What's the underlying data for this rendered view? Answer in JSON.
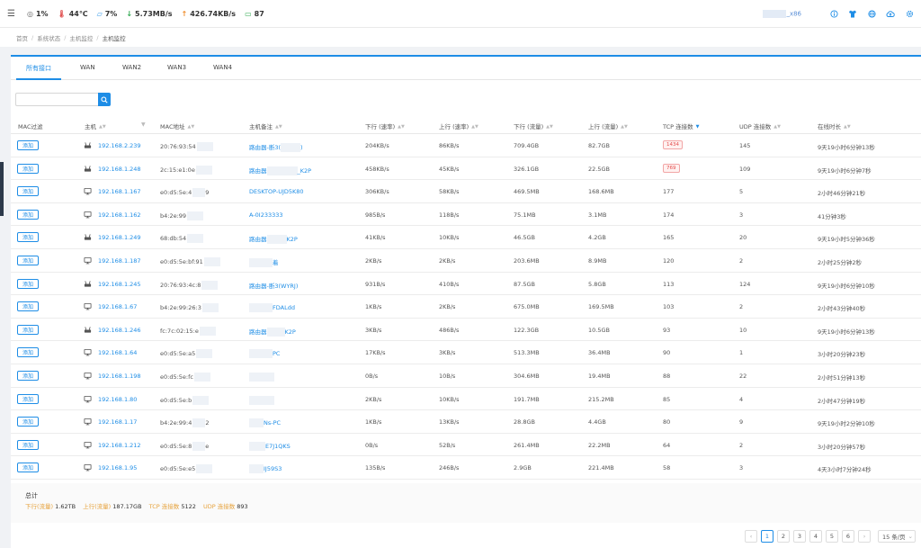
{
  "topbar": {
    "stats": [
      {
        "icon": "cpu-icon",
        "value": "1%",
        "color": "#666666"
      },
      {
        "icon": "thermometer-icon",
        "value": "44℃",
        "color": "#e04f4f"
      },
      {
        "icon": "memory-icon",
        "value": "7%",
        "color": "#3a9be8"
      },
      {
        "icon": "download-arrow-icon",
        "value": "5.73MB/s",
        "color": "#2fa84f"
      },
      {
        "icon": "upload-arrow-icon",
        "value": "426.74KB/s",
        "color": "#f08c2a"
      },
      {
        "icon": "monitor-icon",
        "value": "87",
        "color": "#2fa84f"
      }
    ],
    "arch": "_x86"
  },
  "breadcrumb": [
    "首页",
    "系统状态",
    "主机监控",
    "主机监控"
  ],
  "tabs": [
    "所有接口",
    "WAN",
    "WAN2",
    "WAN3",
    "WAN4"
  ],
  "search": {
    "placeholder": ""
  },
  "columns": [
    "MAC过滤",
    "主机",
    "MAC地址",
    "主机备注",
    "下行 (速率)",
    "上行 (速率)",
    "下行 (流量)",
    "上行 (流量)",
    "TCP 连接数",
    "UDP 连接数",
    "在线时长"
  ],
  "add_label": "添加",
  "rows": [
    {
      "icon": "router",
      "ip": "192.168.2.239",
      "mac": "20:76:93:54",
      "remark": "路由器-断3(",
      "remark_tail": ")",
      "down_rate": "204KB/s",
      "up_rate": "86KB/s",
      "down_total": "709.4GB",
      "up_total": "82.7GB",
      "tcp": "1434",
      "tcp_hot": true,
      "udp": "145",
      "online": "9天19小时6分钟13秒"
    },
    {
      "icon": "router",
      "ip": "192.168.1.248",
      "mac": "2c:15:e1:0e",
      "remark": "路由器",
      "remark_tail": "_K2P",
      "down_rate": "458KB/s",
      "up_rate": "45KB/s",
      "down_total": "326.1GB",
      "up_total": "22.5GB",
      "tcp": "769",
      "tcp_hot": true,
      "udp": "109",
      "online": "9天19小时6分钟7秒"
    },
    {
      "icon": "monitor",
      "ip": "192.168.1.167",
      "mac": "e0:d5:5e:4",
      "mac_tail": "9",
      "remark": "DESKTOP-UJD5K80",
      "remark_tail": "",
      "down_rate": "306KB/s",
      "up_rate": "58KB/s",
      "down_total": "469.5MB",
      "up_total": "168.6MB",
      "tcp": "177",
      "tcp_hot": false,
      "udp": "5",
      "online": "2小时46分钟21秒"
    },
    {
      "icon": "monitor",
      "ip": "192.168.1.162",
      "mac": "b4:2e:99",
      "remark": "A-0I233333",
      "remark_tail": "",
      "down_rate": "985B/s",
      "up_rate": "118B/s",
      "down_total": "75.1MB",
      "up_total": "3.1MB",
      "tcp": "174",
      "tcp_hot": false,
      "udp": "3",
      "online": "41分钟3秒"
    },
    {
      "icon": "router",
      "ip": "192.168.1.249",
      "mac": "68:db:54",
      "remark": "路由器",
      "remark_tail": "K2P",
      "down_rate": "41KB/s",
      "up_rate": "10KB/s",
      "down_total": "46.5GB",
      "up_total": "4.2GB",
      "tcp": "165",
      "tcp_hot": false,
      "udp": "20",
      "online": "9天19小时5分钟36秒"
    },
    {
      "icon": "monitor",
      "ip": "192.168.1.187",
      "mac": "e0:d5:5e:bf:91",
      "remark": "",
      "remark_tail": "着",
      "down_rate": "2KB/s",
      "up_rate": "2KB/s",
      "down_total": "203.6MB",
      "up_total": "8.9MB",
      "tcp": "120",
      "tcp_hot": false,
      "udp": "2",
      "online": "2小时25分钟2秒"
    },
    {
      "icon": "router",
      "ip": "192.168.1.245",
      "mac": "20:76:93:4c:8",
      "remark": "路由器-断3(WYRJ)",
      "remark_tail": "",
      "down_rate": "931B/s",
      "up_rate": "410B/s",
      "down_total": "87.5GB",
      "up_total": "5.8GB",
      "tcp": "113",
      "tcp_hot": false,
      "udp": "124",
      "online": "9天19小时6分钟10秒"
    },
    {
      "icon": "monitor",
      "ip": "192.168.1.67",
      "mac": "b4:2e:99:26:3",
      "remark": "",
      "remark_tail": "FDALdd",
      "down_rate": "1KB/s",
      "up_rate": "2KB/s",
      "down_total": "675.0MB",
      "up_total": "169.5MB",
      "tcp": "103",
      "tcp_hot": false,
      "udp": "2",
      "online": "2小时43分钟40秒"
    },
    {
      "icon": "router",
      "ip": "192.168.1.246",
      "mac": "fc:7c:02:15:e",
      "remark": "路由器",
      "remark_tail": "K2P",
      "down_rate": "3KB/s",
      "up_rate": "486B/s",
      "down_total": "122.3GB",
      "up_total": "10.5GB",
      "tcp": "93",
      "tcp_hot": false,
      "udp": "10",
      "online": "9天19小时6分钟13秒"
    },
    {
      "icon": "monitor",
      "ip": "192.168.1.64",
      "mac": "e0:d5:5e:a5",
      "remark": "",
      "remark_tail": "PC",
      "down_rate": "17KB/s",
      "up_rate": "3KB/s",
      "down_total": "513.3MB",
      "up_total": "36.4MB",
      "tcp": "90",
      "tcp_hot": false,
      "udp": "1",
      "online": "3小时20分钟23秒"
    },
    {
      "icon": "monitor",
      "ip": "192.168.1.198",
      "mac": "e0:d5:5e:fc",
      "remark": "",
      "remark_tail": "",
      "down_rate": "0B/s",
      "up_rate": "10B/s",
      "down_total": "304.6MB",
      "up_total": "19.4MB",
      "tcp": "88",
      "tcp_hot": false,
      "udp": "22",
      "online": "2小时51分钟13秒"
    },
    {
      "icon": "monitor",
      "ip": "192.168.1.80",
      "mac": "e0:d5:5e:b",
      "remark": "",
      "remark_tail": "",
      "down_rate": "2KB/s",
      "up_rate": "10KB/s",
      "down_total": "191.7MB",
      "up_total": "215.2MB",
      "tcp": "85",
      "tcp_hot": false,
      "udp": "4",
      "online": "2小时47分钟19秒"
    },
    {
      "icon": "monitor",
      "ip": "192.168.1.17",
      "mac": "b4:2e:99:4",
      "mac_tail": "2",
      "remark": "",
      "remark_tail": "Ns-PC",
      "down_rate": "1KB/s",
      "up_rate": "13KB/s",
      "down_total": "28.8GB",
      "up_total": "4.4GB",
      "tcp": "80",
      "tcp_hot": false,
      "udp": "9",
      "online": "9天19小时2分钟10秒"
    },
    {
      "icon": "monitor",
      "ip": "192.168.1.212",
      "mac": "e0:d5:5e:8",
      "mac_tail": "e",
      "remark": "",
      "remark_tail": "E7J1QKS",
      "down_rate": "0B/s",
      "up_rate": "52B/s",
      "down_total": "261.4MB",
      "up_total": "22.2MB",
      "tcp": "64",
      "tcp_hot": false,
      "udp": "2",
      "online": "3小时20分钟57秒"
    },
    {
      "icon": "monitor",
      "ip": "192.168.1.95",
      "mac": "e0:d5:5e:e5",
      "remark": "",
      "remark_tail": "IJ59S3",
      "down_rate": "135B/s",
      "up_rate": "246B/s",
      "down_total": "2.9GB",
      "up_total": "221.4MB",
      "tcp": "58",
      "tcp_hot": false,
      "udp": "3",
      "online": "4天3小时7分钟24秒"
    }
  ],
  "summary": {
    "title": "总计",
    "items": [
      {
        "label": "下行(流量)",
        "value": "1.62TB"
      },
      {
        "label": "上行(流量)",
        "value": "187.17GB"
      },
      {
        "label": "TCP 连接数",
        "value": "5122"
      },
      {
        "label": "UDP 连接数",
        "value": "893"
      }
    ]
  },
  "pagination": {
    "pages": [
      "1",
      "2",
      "3",
      "4",
      "5",
      "6"
    ],
    "current": "1",
    "page_size": "15 条/页"
  },
  "colors": {
    "accent": "#1e8de6",
    "warn": "#e6a23c",
    "danger": "#e34d4d"
  }
}
